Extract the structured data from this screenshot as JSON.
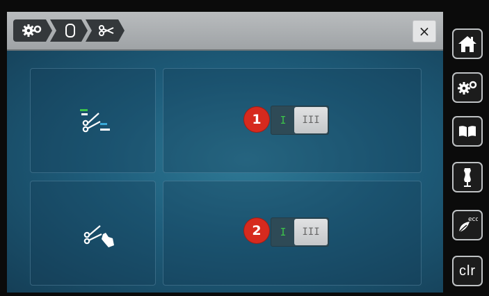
{
  "breadcrumb": [
    {
      "icon": "gears-icon"
    },
    {
      "icon": "hoop-icon"
    },
    {
      "icon": "scissors-icon"
    }
  ],
  "close_label": "×",
  "settings": [
    {
      "badge": "1",
      "icon": "thread-cutter-auto-icon",
      "toggle_on_label": "I",
      "toggle_off_label": "III",
      "state": "off"
    },
    {
      "badge": "2",
      "icon": "thread-cutter-manual-icon",
      "toggle_on_label": "I",
      "toggle_off_label": "III",
      "state": "off"
    }
  ],
  "sidebar": {
    "items": [
      {
        "icon": "home-icon"
      },
      {
        "icon": "settings-gears-icon"
      },
      {
        "icon": "guide-book-icon"
      },
      {
        "icon": "dress-form-icon"
      },
      {
        "icon": "eco-leaf-icon",
        "label": "eco"
      },
      {
        "label": "clr"
      }
    ]
  },
  "colors": {
    "badge": "#d62a1e",
    "toggle_on": "#3cc24a",
    "background": "#1e5d7b"
  }
}
